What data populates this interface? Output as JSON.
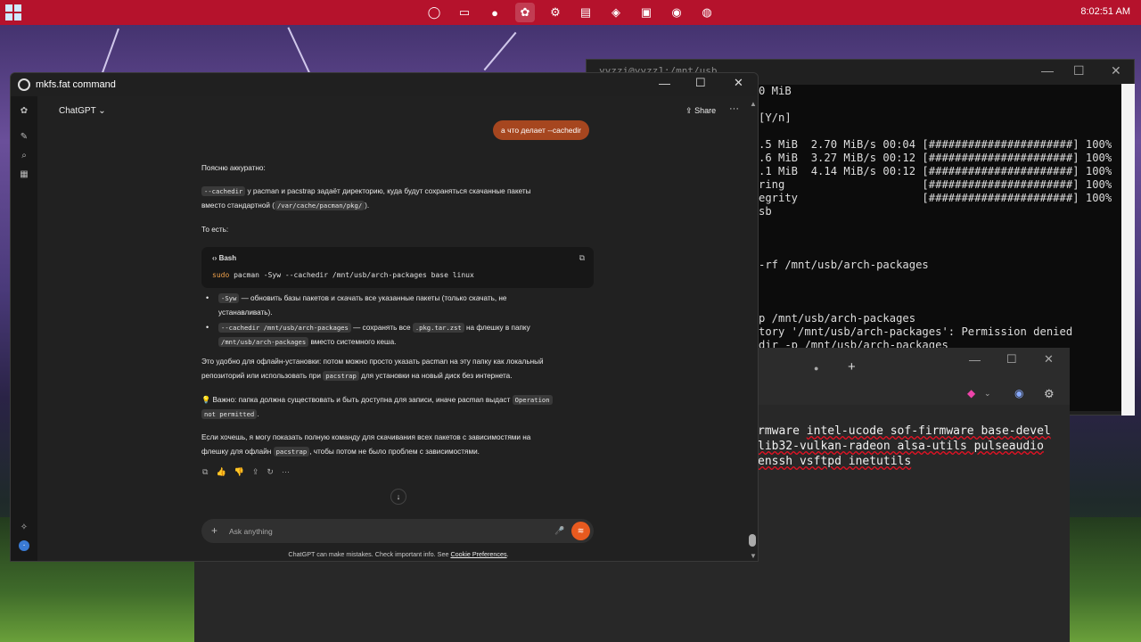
{
  "taskbar": {
    "clock": "8:02:51 AM",
    "apps": [
      "opera-icon",
      "files-icon",
      "record-icon",
      "chatgpt-icon",
      "settings-icon",
      "notepad-icon",
      "vscode-icon",
      "office-icon",
      "github-icon",
      "spotify-icon"
    ]
  },
  "terminal": {
    "title": "yyzzi@yyzz1:/mnt/usb",
    "lines": [
      "0 MiB",
      "",
      "[Y/n]",
      "",
      ".5 MiB  2.70 MiB/s 00:04 [######################] 100%",
      ".6 MiB  3.27 MiB/s 00:12 [######################] 100%",
      ".1 MiB  4.14 MiB/s 00:12 [######################] 100%",
      "ring                     [######################] 100%",
      "egrity                   [######################] 100%",
      "sb",
      "",
      "",
      "",
      "-rf /mnt/usb/arch-packages",
      "",
      "",
      "",
      "p /mnt/usb/arch-packages",
      "tory '/mnt/usb/arch-packages': Permission denied",
      "dir -p /mnt/usb/arch-packages"
    ]
  },
  "terminal2": {
    "lines": [
      {
        "pre": "rmware ",
        "u": "intel-ucode sof-firmware base-devel"
      },
      {
        "pre": "",
        "u": "lib32-vulkan-radeon alsa-utils pulseaudio"
      },
      {
        "pre": "",
        "u": "enssh vsftpd inetutils"
      }
    ]
  },
  "chat": {
    "window_title": "mkfs.fat command",
    "model_label": "ChatGPT",
    "share_label": "Share",
    "user_message": "а что делает --cachedir",
    "intro": "Поясню аккуратно:",
    "p1_code": "--cachedir",
    "p1_text_a": " у pacman и pacstrap задаёт директорию, куда будут сохраняться скачанные пакеты",
    "p1_text_b": "вместо стандартной (",
    "p1_code2": "/var/cache/pacman/pkg/",
    "p1_text_c": ").",
    "that_is": "То есть:",
    "code_lang": "Bash",
    "code_cmd_kw": "sudo",
    "code_cmd": " pacman -Syw --cachedir /mnt/usb/arch-packages base linux",
    "b1_code": "-Syw",
    "b1_text_a": " — обновить базы пакетов и скачать все указанные пакеты (только скачать, не",
    "b1_text_b": "устанавливать).",
    "b2_code": "--cachedir /mnt/usb/arch-packages",
    "b2_text_a": " — сохранять все ",
    "b2_code2": ".pkg.tar.zst",
    "b2_text_b": " на флешку в папку",
    "b2_code3": "/mnt/usb/arch-packages",
    "b2_text_c": " вместо системного кеша.",
    "p2_a": "Это удобно для офлайн-установки: потом можно просто указать pacman на эту папку как локальный",
    "p2_b": "репозиторий или использовать при ",
    "p2_code": "pacstrap",
    "p2_c": " для установки на новый диск без интернета.",
    "p3_a": "💡 Важно: папка должна существовать и быть доступна для записи, иначе pacman выдаст ",
    "p3_code": "Operation",
    "p3_code2": "not permitted",
    "p3_b": ".",
    "p4_a": "Если хочешь, я могу показать полную команду для скачивания всех пакетов с зависимостями на",
    "p4_b": "флешку для офлайн ",
    "p4_code": "pacstrap",
    "p4_c": ", чтобы потом не было проблем с зависимостями.",
    "composer_placeholder": "Ask anything",
    "footer_text": "ChatGPT can make mistakes. Check important info. See ",
    "footer_link": "Cookie Preferences",
    "footer_end": "."
  },
  "colors": {
    "taskbar": "#b5122c",
    "user_bubble": "#a6461f",
    "voice_button": "#e85a1f"
  }
}
